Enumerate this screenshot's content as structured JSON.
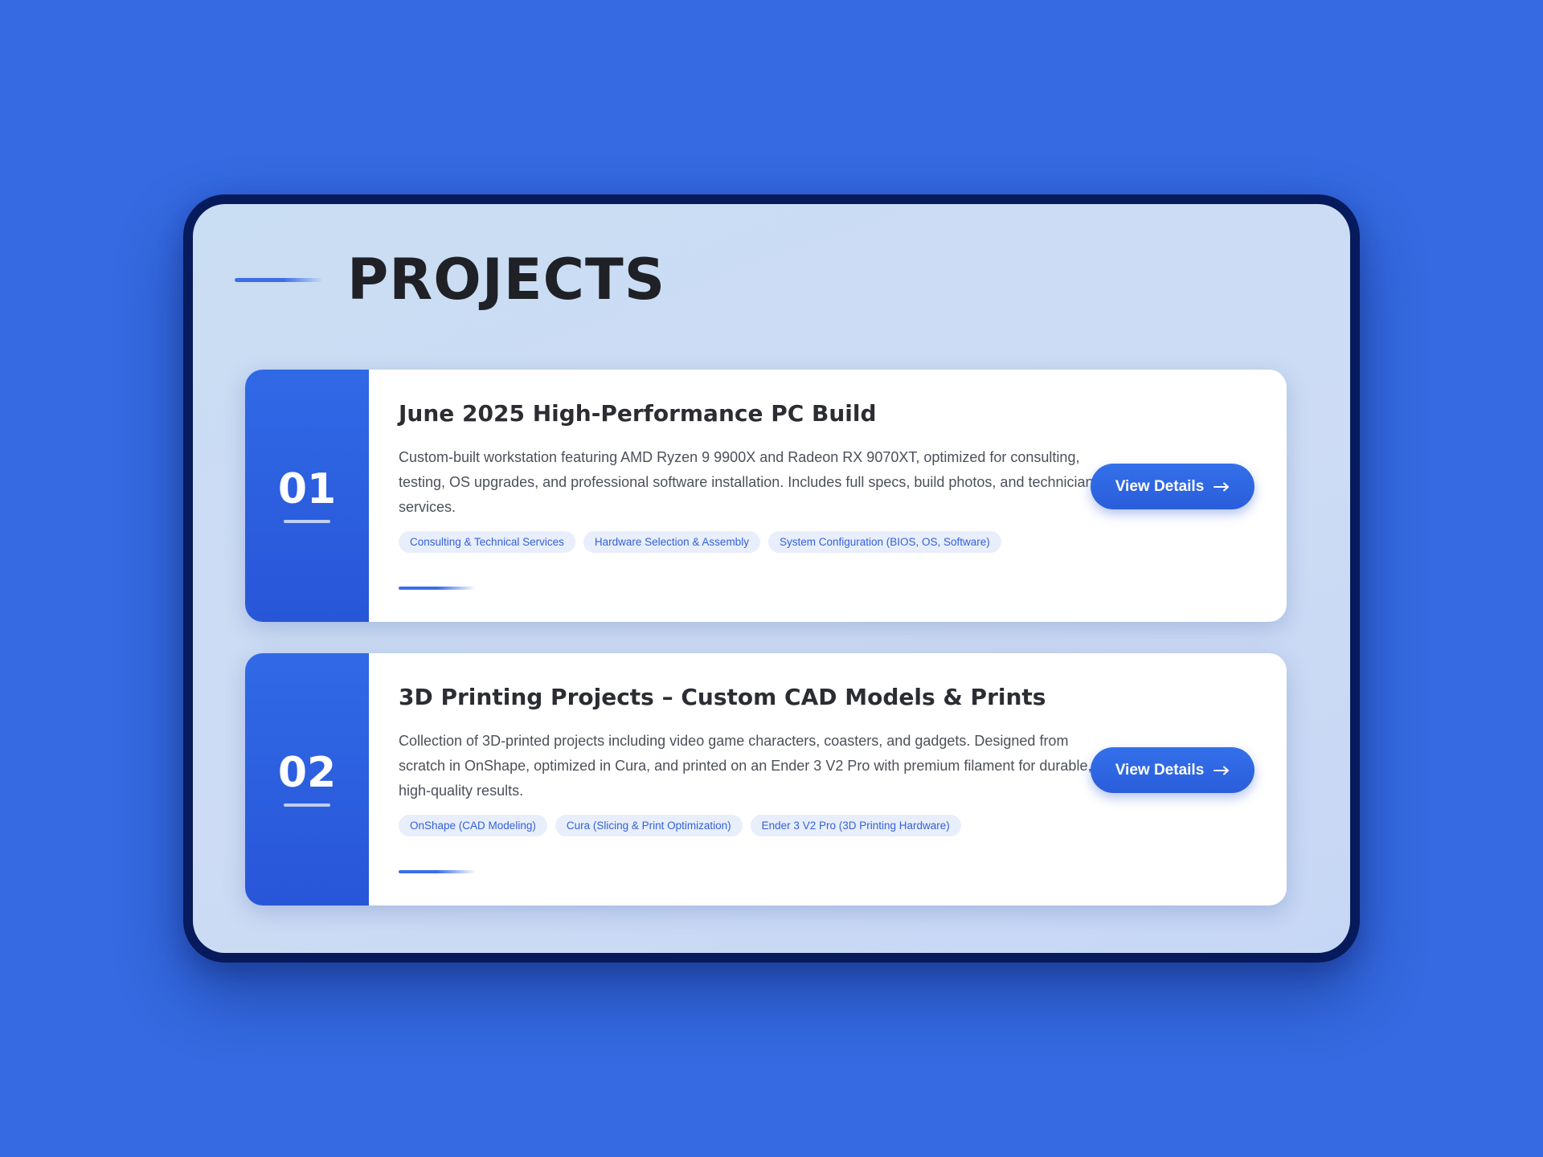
{
  "section": {
    "title": "PROJECTS"
  },
  "projects": [
    {
      "number": "01",
      "title": "June 2025 High-Performance PC Build",
      "description": "Custom-built workstation featuring AMD Ryzen 9 9900X and Radeon RX 9070XT, optimized for consulting, testing, OS upgrades, and professional software installation. Includes full specs, build photos, and technician services.",
      "tags": [
        "Consulting & Technical Services",
        "Hardware Selection & Assembly",
        "System Configuration (BIOS, OS, Software)"
      ],
      "button_label": "View Details",
      "button_icon": "arrow-right-icon"
    },
    {
      "number": "02",
      "title": "3D Printing Projects – Custom CAD Models & Prints",
      "description": "Collection of 3D-printed projects including video game characters, coasters, and gadgets. Designed from scratch in OnShape, optimized in Cura, and printed on an Ender 3 V2 Pro with premium filament for durable, high-quality results.",
      "tags": [
        "OnShape (CAD Modeling)",
        "Cura (Slicing & Print Optimization)",
        "Ender 3 V2 Pro (3D Printing Hardware)"
      ],
      "button_label": "View Details",
      "button_icon": "arrow-right-icon"
    }
  ],
  "colors": {
    "background": "#356ae2",
    "accent": "#2f63e3",
    "frame": "#061a5c",
    "title_text": "#1f2126"
  }
}
